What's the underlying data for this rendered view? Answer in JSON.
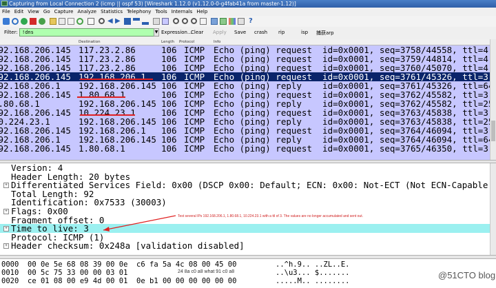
{
  "window": {
    "title": "Capturing from Local Connection 2 (icmp || ospf 53) [Wireshark 1.12.0 (v1.12.0-0-g4fab41a from master-1.12)]"
  },
  "menu": [
    "File",
    "Edit",
    "View",
    "Go",
    "Capture",
    "Analyze",
    "Statistics",
    "Telephony",
    "Tools",
    "Internals",
    "Help"
  ],
  "filter": {
    "label": "Filter:",
    "value": "!dns",
    "buttons": [
      "Expression...",
      "Clear",
      "Apply",
      "Save",
      "crash",
      "rip",
      "isp",
      "捕获arp"
    ]
  },
  "packet_list": {
    "columns": [
      "Destination",
      "Length",
      "Protocol",
      "Info"
    ],
    "rows": [
      {
        "src": "192.168.206.145",
        "dst": "117.23.2.86",
        "len": "106",
        "proto": "ICMP",
        "info": "Echo (ping) request  id=0x0001, seq=3758/44558, ttl=4 (no"
      },
      {
        "src": "192.168.206.145",
        "dst": "117.23.2.86",
        "len": "106",
        "proto": "ICMP",
        "info": "Echo (ping) request  id=0x0001, seq=3759/44814, ttl=4 (no"
      },
      {
        "src": "192.168.206.145",
        "dst": "117.23.2.86",
        "len": "106",
        "proto": "ICMP",
        "info": "Echo (ping) request  id=0x0001, seq=3760/45070, ttl=4 (no"
      },
      {
        "src": "192.168.206.145",
        "dst": "192.168.206.1",
        "len": "106",
        "proto": "ICMP",
        "info": "Echo (ping) request  id=0x0001, seq=3761/45326, ttl=3 (re"
      },
      {
        "src": "192.168.206.1",
        "dst": "192.168.206.145",
        "len": "106",
        "proto": "ICMP",
        "info": "Echo (ping) reply    id=0x0001, seq=3761/45326, ttl=64 (r"
      },
      {
        "src": "192.168.206.145",
        "dst": "1.80.68.1",
        "len": "106",
        "proto": "ICMP",
        "info": "Echo (ping) request  id=0x0001, seq=3762/45582, ttl=3 (re"
      },
      {
        "src": "1.80.68.1",
        "dst": "192.168.206.145",
        "len": "106",
        "proto": "ICMP",
        "info": "Echo (ping) reply    id=0x0001, seq=3762/45582, ttl=254 ("
      },
      {
        "src": "192.168.206.145",
        "dst": "10.224.23.1",
        "len": "106",
        "proto": "ICMP",
        "info": "Echo (ping) request  id=0x0001, seq=3763/45838, ttl=3 (re"
      },
      {
        "src": "10.224.23.1",
        "dst": "192.168.206.145",
        "len": "106",
        "proto": "ICMP",
        "info": "Echo (ping) reply    id=0x0001, seq=3763/45838, ttl=253 ("
      },
      {
        "src": "192.168.206.145",
        "dst": "192.168.206.1",
        "len": "106",
        "proto": "ICMP",
        "info": "Echo (ping) request  id=0x0001, seq=3764/46094, ttl=3 (re"
      },
      {
        "src": "192.168.206.1",
        "dst": "192.168.206.145",
        "len": "106",
        "proto": "ICMP",
        "info": "Echo (ping) reply    id=0x0001, seq=3764/46094, ttl=64 (r"
      },
      {
        "src": "192.168.206.145",
        "dst": "1.80.68.1",
        "len": "106",
        "proto": "ICMP",
        "info": "Echo (ping) request  id=0x0001, seq=3765/46350, ttl=3 (re"
      }
    ]
  },
  "details": {
    "rows": [
      {
        "text": "Version: 4",
        "expandable": false,
        "hl": false
      },
      {
        "text": "Header Length: 20 bytes",
        "expandable": false,
        "hl": false
      },
      {
        "text": "Differentiated Services Field: 0x00 (DSCP 0x00: Default; ECN: 0x00: Not-ECT (Not ECN-Capable Transp",
        "expandable": true,
        "hl": false
      },
      {
        "text": "Total Length: 92",
        "expandable": false,
        "hl": false
      },
      {
        "text": "Identification: 0x7533 (30003)",
        "expandable": false,
        "hl": false
      },
      {
        "text": "Flags: 0x00",
        "expandable": true,
        "hl": false
      },
      {
        "text": "Fragment offset: 0",
        "expandable": false,
        "hl": false
      },
      {
        "text": "Time to live: 3",
        "expandable": true,
        "hl": true
      },
      {
        "text": "Protocol: ICMP (1)",
        "expandable": false,
        "hl": false
      },
      {
        "text": "Header checksum: 0x248a [validation disabled]",
        "expandable": true,
        "hl": false
      }
    ],
    "annotation": "Test several IPs 192.168.206.1, 1.80.68.1, 10.224.23.1 with a ttl of 3. The values are no longer accumulated and sent out."
  },
  "hex": {
    "rows": [
      {
        "offset": "0000",
        "bytes": "00 0e 5e 68 08 39 00 0e  c6 fa 5a 4c 08 00 45 00",
        "ascii": "..^h.9.. ..ZL..E."
      },
      {
        "offset": "0010",
        "bytes": "00 5c 75 33 00 00 03 01  ",
        "ascii": "..\\u3... $......."
      },
      {
        "offset": "0020",
        "bytes": "ce 01 08 00 e9 4d 00 01  0e b1 00 00 00 00 00 00",
        "ascii": ".....M.. ........"
      }
    ],
    "note": "24 8a c0 a8 what 91 c0 a8",
    "watermark": "@51CTO blog"
  }
}
